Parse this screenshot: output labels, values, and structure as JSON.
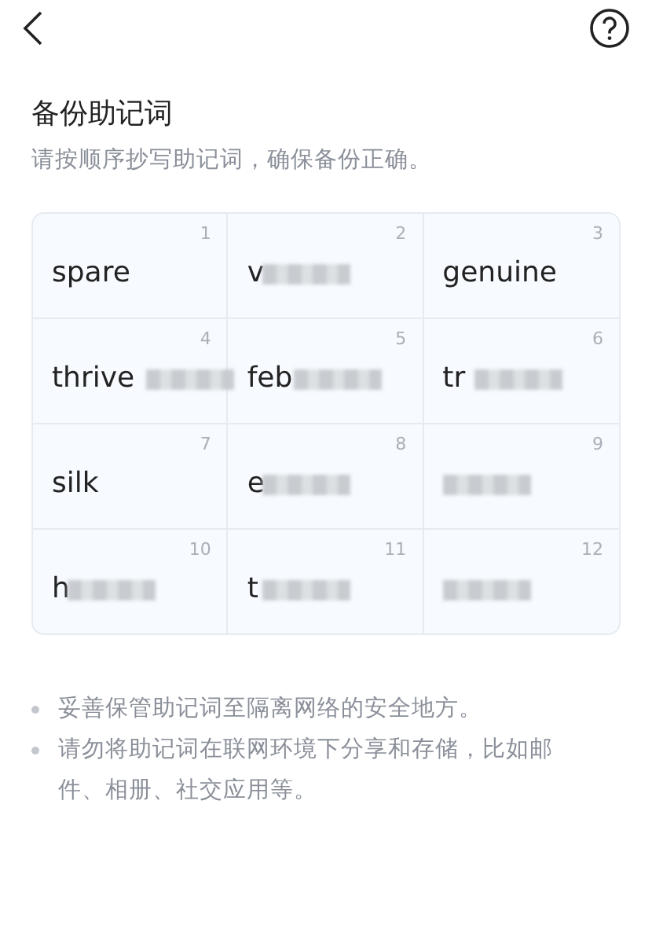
{
  "title": "备份助记词",
  "subtitle": "请按顺序抄写助记词，确保备份正确。",
  "words": [
    {
      "index": "1",
      "word": "spare",
      "redacted": false
    },
    {
      "index": "2",
      "word": "v",
      "redacted": true
    },
    {
      "index": "3",
      "word": "genuine",
      "redacted": false
    },
    {
      "index": "4",
      "word": "thrive",
      "redacted": true
    },
    {
      "index": "5",
      "word": "feb",
      "redacted": true
    },
    {
      "index": "6",
      "word": "tr",
      "redacted": true
    },
    {
      "index": "7",
      "word": "silk",
      "redacted": false
    },
    {
      "index": "8",
      "word": "e",
      "redacted": true
    },
    {
      "index": "9",
      "redacted": true
    },
    {
      "index": "10",
      "word": "h",
      "redacted": true
    },
    {
      "index": "11",
      "word": "t",
      "redacted": true
    },
    {
      "index": "12",
      "redacted": true
    }
  ],
  "tips": [
    "妥善保管助记词至隔离网络的安全地方。",
    "请勿将助记词在联网环境下分享和存储，比如邮件、相册、社交应用等。"
  ]
}
